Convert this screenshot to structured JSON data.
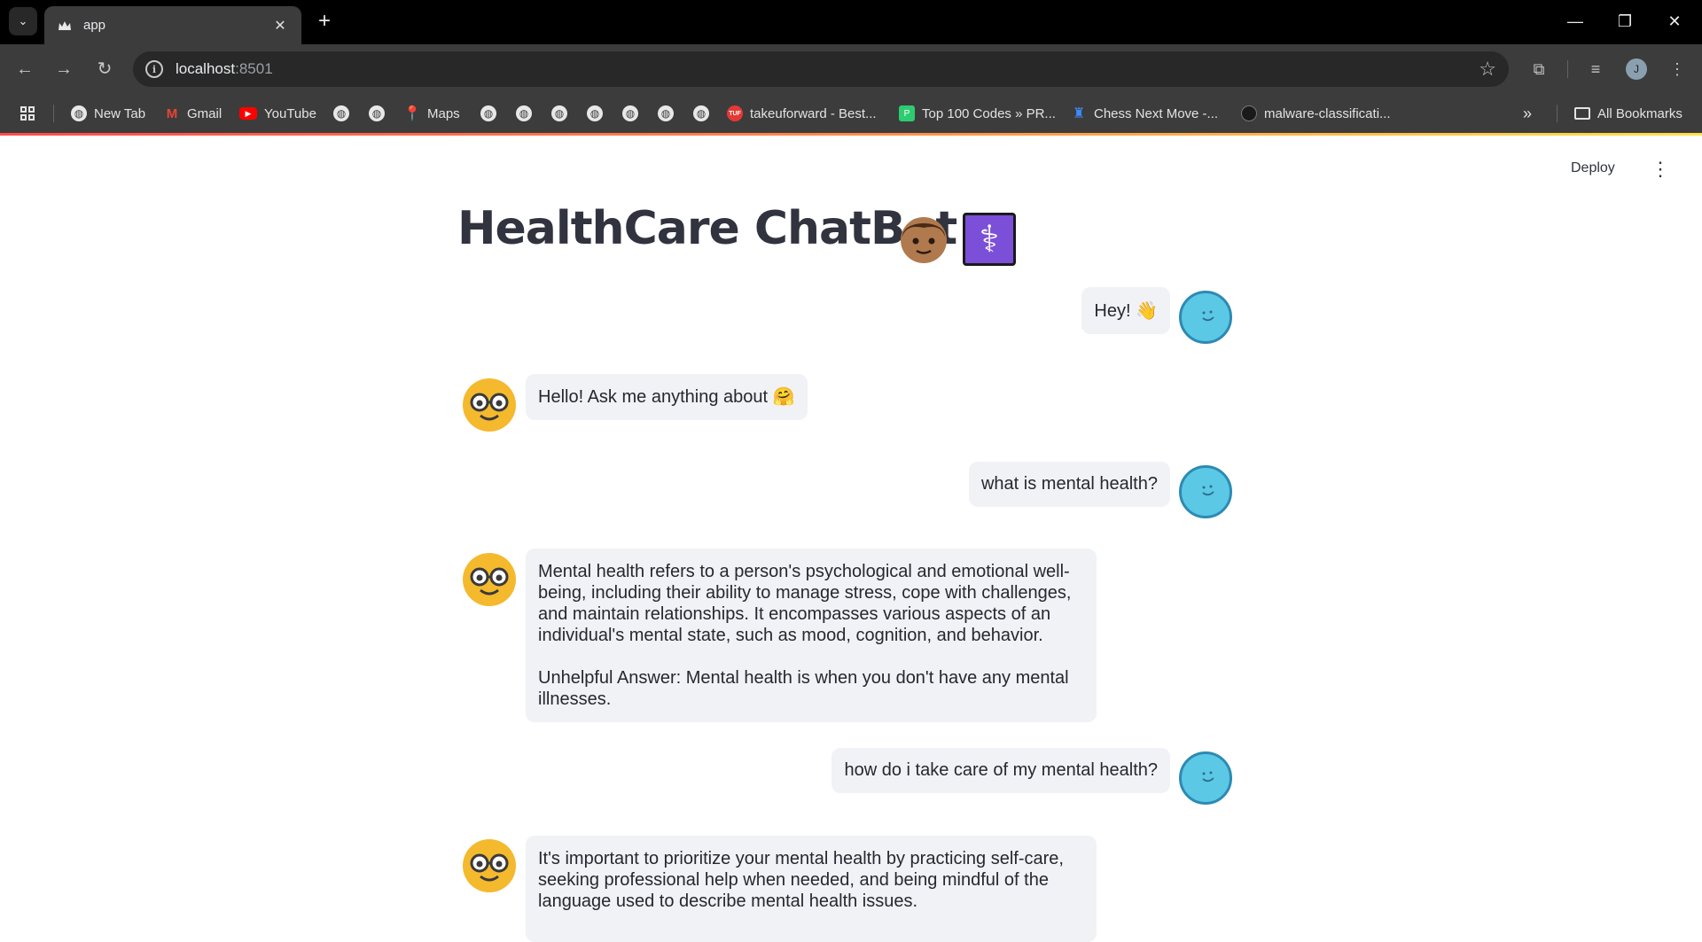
{
  "browser": {
    "tab_title": "app",
    "url_host": "localhost",
    "url_port": ":8501",
    "bookmarks": {
      "new_tab": "New Tab",
      "gmail": "Gmail",
      "youtube": "YouTube",
      "maps": "Maps",
      "takeuforward": "takeuforward - Best...",
      "top100": "Top 100 Codes » PR...",
      "chess": "Chess Next Move -...",
      "malware": "malware-classificati...",
      "all_bookmarks": "All Bookmarks"
    },
    "profile_initial": "J"
  },
  "app": {
    "deploy_label": "Deploy",
    "title": "HealthCare ChatBot",
    "messages": [
      {
        "role": "user",
        "text": "Hey! 👋"
      },
      {
        "role": "bot",
        "text": "Hello! Ask me anything about 🤗"
      },
      {
        "role": "user",
        "text": "what is mental health?"
      },
      {
        "role": "bot",
        "text": "Mental health refers to a person's psychological and emotional well-being, including their ability to manage stress, cope with challenges, and maintain relationships. It encompasses various aspects of an individual's mental state, such as mood, cognition, and behavior.",
        "text2": "Unhelpful Answer: Mental health is when you don't have any mental illnesses."
      },
      {
        "role": "user",
        "text": "how do i take care of my mental health?"
      },
      {
        "role": "bot",
        "text": "It's important to prioritize your mental health by practicing self-care, seeking professional help when needed, and being mindful of the language used to describe mental health issues."
      }
    ]
  },
  "colors": {
    "chrome_bg": "#000000",
    "toolbar_bg": "#3c3c3c",
    "bubble_bg": "#f0f2f6",
    "user_avatar": "#5bc8e6",
    "bot_avatar": "#f5b92e",
    "title_text": "#31333f"
  },
  "icons": [
    "tab-search-icon",
    "streamlit-crown-icon",
    "close-icon",
    "plus-icon",
    "minimize-icon",
    "restore-icon",
    "back-icon",
    "forward-icon",
    "reload-icon",
    "info-icon",
    "star-icon",
    "extensions-icon",
    "media-icon",
    "more-icon",
    "apps-icon",
    "globe-icon",
    "folder-icon",
    "chevron-double-right-icon"
  ]
}
